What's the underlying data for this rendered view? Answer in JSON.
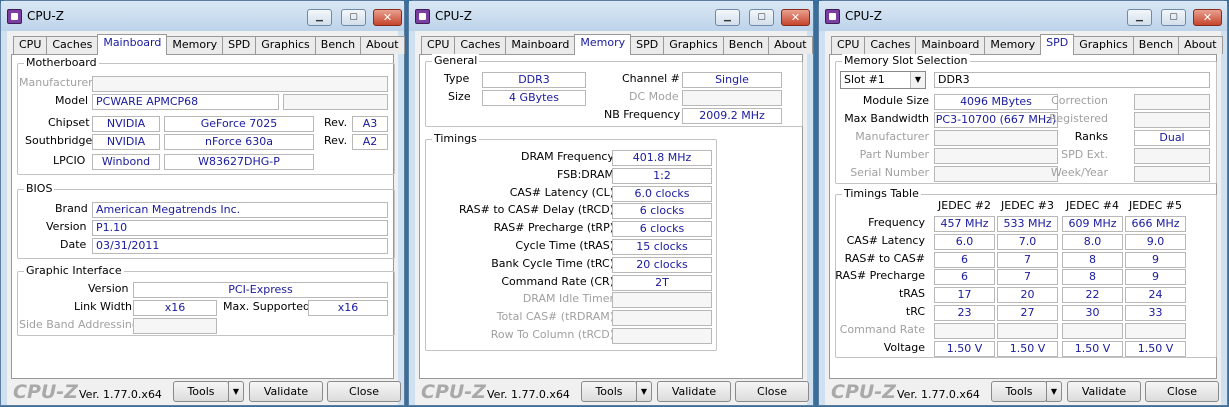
{
  "app_title": "CPU-Z",
  "tabs": [
    "CPU",
    "Caches",
    "Mainboard",
    "Memory",
    "SPD",
    "Graphics",
    "Bench",
    "About"
  ],
  "bottom": {
    "logo": "CPU-Z",
    "version": "Ver. 1.77.0.x64",
    "tools": "Tools",
    "validate": "Validate",
    "close": "Close"
  },
  "mainboard": {
    "motherboard": {
      "title": "Motherboard",
      "manufacturer_label": "Manufacturer",
      "manufacturer": "",
      "model_label": "Model",
      "model": "PCWARE APMCP68",
      "model_rev": "",
      "chipset_label": "Chipset",
      "chipset_vendor": "NVIDIA",
      "chipset_name": "GeForce 7025",
      "rev_label": "Rev.",
      "chipset_rev": "A3",
      "southbridge_label": "Southbridge",
      "southbridge_vendor": "NVIDIA",
      "southbridge_name": "nForce 630a",
      "southbridge_rev": "A2",
      "lpcio_label": "LPCIO",
      "lpcio_vendor": "Winbond",
      "lpcio_name": "W83627DHG-P"
    },
    "bios": {
      "title": "BIOS",
      "brand_label": "Brand",
      "brand": "American Megatrends Inc.",
      "version_label": "Version",
      "version": "P1.10",
      "date_label": "Date",
      "date": "03/31/2011"
    },
    "graphic": {
      "title": "Graphic Interface",
      "version_label": "Version",
      "version": "PCI-Express",
      "link_width_label": "Link Width",
      "link_width": "x16",
      "max_supported_label": "Max. Supported",
      "max_supported": "x16",
      "side_band_label": "Side Band Addressing",
      "side_band": ""
    }
  },
  "memory": {
    "general": {
      "title": "General",
      "type_label": "Type",
      "type": "DDR3",
      "size_label": "Size",
      "size": "4 GBytes",
      "channel_label": "Channel #",
      "channel": "Single",
      "dc_mode_label": "DC Mode",
      "dc_mode": "",
      "nb_freq_label": "NB Frequency",
      "nb_freq": "2009.2 MHz"
    },
    "timings": {
      "title": "Timings",
      "rows": [
        {
          "label": "DRAM Frequency",
          "value": "401.8 MHz",
          "dim": false
        },
        {
          "label": "FSB:DRAM",
          "value": "1:2",
          "dim": false
        },
        {
          "label": "CAS# Latency (CL)",
          "value": "6.0 clocks",
          "dim": false
        },
        {
          "label": "RAS# to CAS# Delay (tRCD)",
          "value": "6 clocks",
          "dim": false
        },
        {
          "label": "RAS# Precharge (tRP)",
          "value": "6 clocks",
          "dim": false
        },
        {
          "label": "Cycle Time (tRAS)",
          "value": "15 clocks",
          "dim": false
        },
        {
          "label": "Bank Cycle Time (tRC)",
          "value": "20 clocks",
          "dim": false
        },
        {
          "label": "Command Rate (CR)",
          "value": "2T",
          "dim": false
        },
        {
          "label": "DRAM Idle Timer",
          "value": "",
          "dim": true
        },
        {
          "label": "Total CAS# (tRDRAM)",
          "value": "",
          "dim": true
        },
        {
          "label": "Row To Column (tRCD)",
          "value": "",
          "dim": true
        }
      ]
    }
  },
  "spd": {
    "slot": {
      "title": "Memory Slot Selection",
      "slot_value": "Slot #1",
      "mem_type": "DDR3",
      "left_rows": [
        {
          "label": "Module Size",
          "value": "4096 MBytes",
          "dim": false
        },
        {
          "label": "Max Bandwidth",
          "value": "PC3-10700 (667 MHz)",
          "dim": false
        },
        {
          "label": "Manufacturer",
          "value": "",
          "dim": true
        },
        {
          "label": "Part Number",
          "value": "",
          "dim": true
        },
        {
          "label": "Serial Number",
          "value": "",
          "dim": true
        }
      ],
      "right_rows": [
        {
          "label": "Correction",
          "value": "",
          "dim": true
        },
        {
          "label": "Registered",
          "value": "",
          "dim": true
        },
        {
          "label": "Ranks",
          "value": "Dual",
          "dim": false
        },
        {
          "label": "SPD Ext.",
          "value": "",
          "dim": true
        },
        {
          "label": "Week/Year",
          "value": "",
          "dim": true
        }
      ]
    },
    "timings_table": {
      "title": "Timings Table",
      "headers": [
        "JEDEC #2",
        "JEDEC #3",
        "JEDEC #4",
        "JEDEC #5"
      ],
      "rows": [
        {
          "label": "Frequency",
          "values": [
            "457 MHz",
            "533 MHz",
            "609 MHz",
            "666 MHz"
          ],
          "dim": false
        },
        {
          "label": "CAS# Latency",
          "values": [
            "6.0",
            "7.0",
            "8.0",
            "9.0"
          ],
          "dim": false
        },
        {
          "label": "RAS# to CAS#",
          "values": [
            "6",
            "7",
            "8",
            "9"
          ],
          "dim": false
        },
        {
          "label": "RAS# Precharge",
          "values": [
            "6",
            "7",
            "8",
            "9"
          ],
          "dim": false
        },
        {
          "label": "tRAS",
          "values": [
            "17",
            "20",
            "22",
            "24"
          ],
          "dim": false
        },
        {
          "label": "tRC",
          "values": [
            "23",
            "27",
            "30",
            "33"
          ],
          "dim": false
        },
        {
          "label": "Command Rate",
          "values": [
            "",
            "",
            "",
            ""
          ],
          "dim": true
        },
        {
          "label": "Voltage",
          "values": [
            "1.50 V",
            "1.50 V",
            "1.50 V",
            "1.50 V"
          ],
          "dim": false
        }
      ]
    }
  }
}
